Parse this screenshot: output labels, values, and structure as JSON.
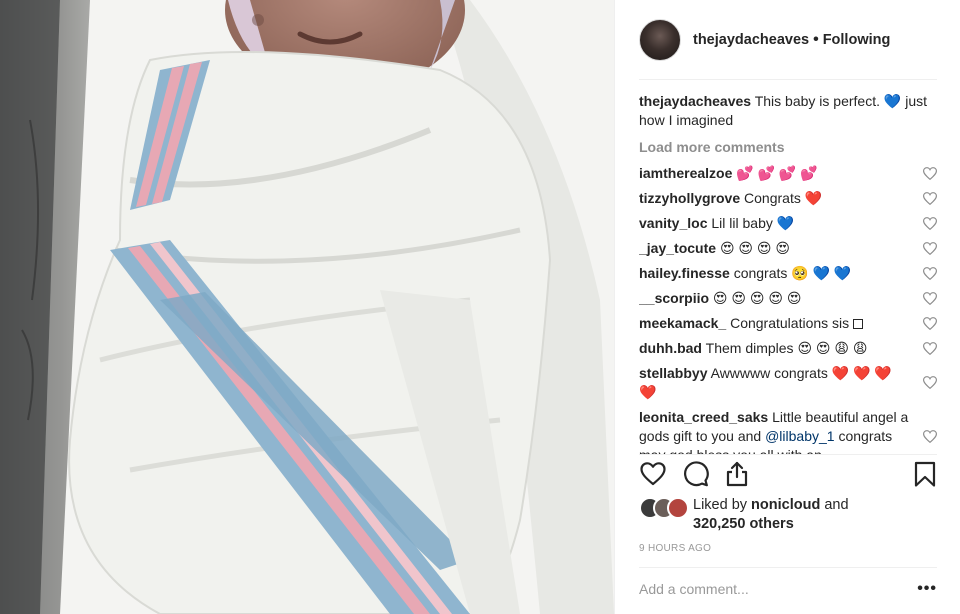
{
  "post": {
    "username": "thejaydacheaves",
    "separator": "•",
    "follow_status": "Following"
  },
  "caption": {
    "username": "thejaydacheaves",
    "text": "This baby is perfect. 💙 just how I imagined"
  },
  "load_more": "Load more comments",
  "comments": [
    {
      "username": "iamtherealzoe",
      "text": "💕 💕 💕 💕"
    },
    {
      "username": "tizzyhollygrove",
      "text": "Congrats ❤️"
    },
    {
      "username": "vanity_loc",
      "text": "Lil lil baby 💙"
    },
    {
      "username": "_jay_tocute",
      "text": "😍 😍 😍 😍"
    },
    {
      "username": "hailey.finesse",
      "text": "congrats 🥺 💙 💙"
    },
    {
      "username": "__scorpiio",
      "text": "😍 😍 😍 😍 😍"
    },
    {
      "username": "meekamack_",
      "text": "Congratulations sis"
    },
    {
      "username": "duhh.bad",
      "text": "Them dimples 😍 😍 😩 😩"
    },
    {
      "username": "stellabbyy",
      "text": "Awwwww congrats ❤️ ❤️ ❤️ ❤️"
    },
    {
      "username": "leonita_creed_saks",
      "text": "Little beautiful angel a gods gift to you and",
      "mention": "@lilbaby_1",
      "text2": "congrats may god bless you all with an"
    }
  ],
  "likes": {
    "prefix": "Liked by",
    "username": "nonicloud",
    "suffix": "and",
    "others": "320,250 others"
  },
  "timestamp": "9 HOURS AGO",
  "add_comment_placeholder": "Add a comment...",
  "more_label": "•••",
  "icons": {
    "like": "heart-icon",
    "comment": "speech-bubble-icon",
    "share": "share-icon",
    "save": "bookmark-icon"
  },
  "colors": {
    "text": "#262626",
    "muted": "#999999",
    "mention": "#003569",
    "border": "#efefef"
  }
}
